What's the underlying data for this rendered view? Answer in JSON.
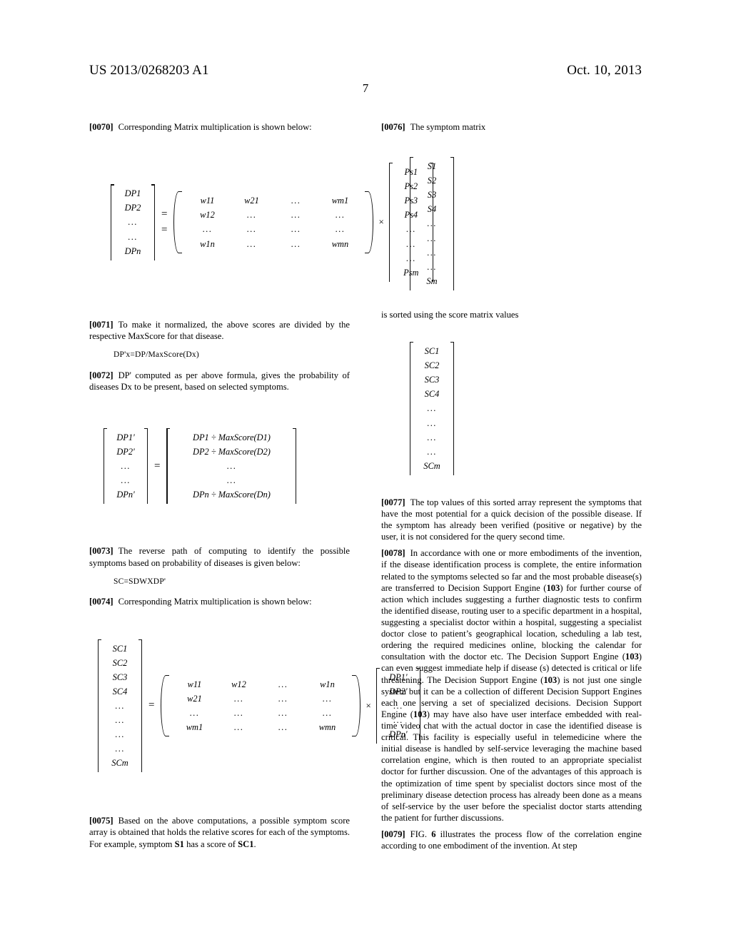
{
  "header": {
    "publication_number": "US 2013/0268203 A1",
    "publication_date": "Oct. 10, 2013",
    "page_number": "7"
  },
  "left_column": {
    "para_0070": {
      "number": "[0070]",
      "text": "Corresponding Matrix multiplication is shown below:"
    },
    "matrix_1": {
      "lhs_label": "DP column vector",
      "lhs": [
        "DP1",
        "DP2",
        "...",
        "...",
        "DPn"
      ],
      "equals": "=",
      "equals_second": "=",
      "weights": [
        [
          "w11",
          "w21",
          "...",
          "wm1"
        ],
        [
          "w12",
          "...",
          "...",
          "..."
        ],
        [
          "...",
          "...",
          "...",
          "..."
        ],
        [
          "w1n",
          "...",
          "...",
          "wmn"
        ]
      ],
      "times": "×",
      "rhs": [
        "Ps1",
        "Ps2",
        "Ps3",
        "Ps4",
        "...",
        "...",
        "...",
        "Psm"
      ]
    },
    "para_0071": {
      "number": "[0071]",
      "text": "To make it normalized, the above scores are divided by the respective MaxScore for that disease."
    },
    "formula_1": "DP'x=DP/MaxScore(Dx)",
    "para_0072": {
      "number": "[0072]",
      "text": "DP' computed as per above formula, gives the probability of diseases Dx to be present, based on selected symptoms."
    },
    "matrix_2": {
      "lhs": [
        "DP1'",
        "DP2'",
        "...",
        "...",
        "DPn'"
      ],
      "equals": "=",
      "rhs": [
        "DP1 ÷ MaxScore(D1)",
        "DP2 ÷ MaxScore(D2)",
        "...",
        "...",
        "DPn ÷ MaxScore(Dn)"
      ]
    },
    "para_0073": {
      "number": "[0073]",
      "text": "The reverse path of computing to identify the possible symptoms based on probability of diseases is given below:"
    },
    "formula_2": "SC=SDWXDP'",
    "para_0074": {
      "number": "[0074]",
      "text": "Corresponding Matrix multiplication is shown below:"
    },
    "matrix_3": {
      "lhs": [
        "SC1",
        "SC2",
        "SC3",
        "SC4",
        "...",
        "...",
        "...",
        "...",
        "SCm"
      ],
      "equals": "=",
      "weights": [
        [
          "w11",
          "w12",
          "...",
          "w1n"
        ],
        [
          "w21",
          "...",
          "...",
          "..."
        ],
        [
          "...",
          "...",
          "...",
          "..."
        ],
        [
          "wm1",
          "...",
          "...",
          "wmn"
        ]
      ],
      "times": "×",
      "rhs": [
        "DP1'",
        "DP2'",
        "...",
        "...",
        "DPn'"
      ]
    },
    "para_0075": {
      "number": "[0075]",
      "text_before": "Based on the above computations, a possible symptom score array is obtained that holds the relative scores for each of the symptoms. For example, symptom ",
      "bold_1": "S1",
      "text_middle": " has a score of ",
      "bold_2": "SC1",
      "text_after": "."
    }
  },
  "right_column": {
    "para_0076": {
      "number": "[0076]",
      "text": "The symptom matrix"
    },
    "symptom_matrix": [
      "S1",
      "S2",
      "S3",
      "S4",
      "...",
      "...",
      "...",
      "...",
      "Sm"
    ],
    "sorted_note": "is sorted using the score matrix values",
    "score_matrix": [
      "SC1",
      "SC2",
      "SC3",
      "SC4",
      "...",
      "...",
      "...",
      "...",
      "SCm"
    ],
    "para_0077": {
      "number": "[0077]",
      "text": "The top values of this sorted array represent the symptoms that have the most potential for a quick decision of the possible disease. If the symptom has already been verified (positive or negative) by the user, it is not considered for the query second time."
    },
    "para_0078": {
      "number": "[0078]",
      "segment_1": "In accordance with one or more embodiments of the invention, if the disease identification process is complete, the entire information related to the symptoms selected so far and the most probable disease(s) are transferred to Decision Support Engine (",
      "ref_1": "103",
      "segment_2": ") for further course of action which includes suggesting a further diagnostic tests to confirm the identified disease, routing user to a specific department in a hospital, suggesting a specialist doctor within a hospital, suggesting a specialist doctor close to patient’s geographical location, scheduling a lab test, ordering the required medicines online, blocking the calendar for consultation with the doctor etc. The Decision Support Engine (",
      "ref_2": "103",
      "segment_3": ") can even suggest immediate help if disease (s) detected is critical or life threatening. The Decision Support Engine (",
      "ref_3": "103",
      "segment_4": ") is not just one single system but it can be a collection of different Decision Support Engines each one serving a set of specialized decisions. Decision Support Engine (",
      "ref_4": "103",
      "segment_5": ") may have also have user interface embedded with real-time video chat with the actual doctor in case the identified disease is critical. This facility is especially useful in telemedicine where the initial disease is handled by self-service leveraging the machine based correlation engine, which is then routed to an appropriate specialist doctor for further discussion. One of the advantages of this approach is the optimization of time spent by specialist doctors since most of the preliminary disease detection process has already been done as a means of self-service by the user before the specialist doctor starts attending the patient for further discussions."
    },
    "para_0079": {
      "number": "[0079]",
      "segment_1": "FIG. ",
      "ref_1": "6",
      "segment_2": " illustrates the process flow of the correlation engine according to one embodiment of the invention. At step"
    }
  }
}
